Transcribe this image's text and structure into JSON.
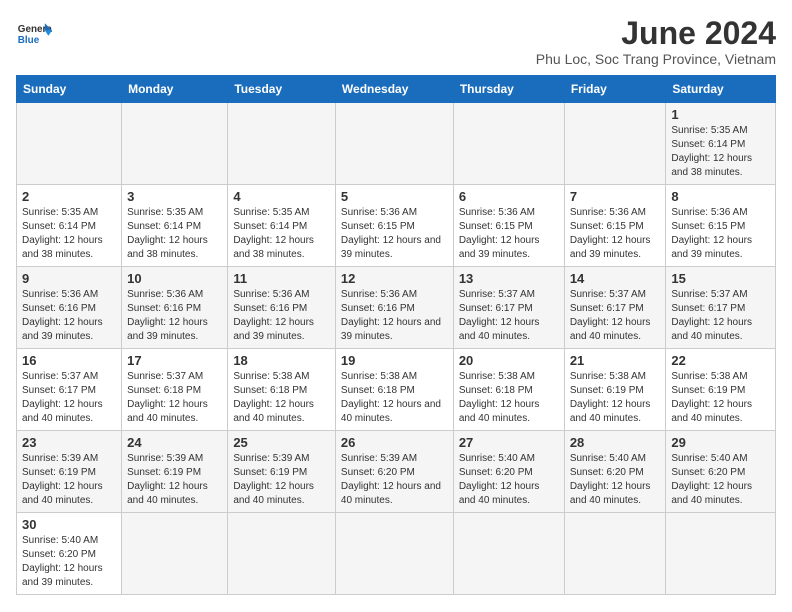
{
  "header": {
    "logo_general": "General",
    "logo_blue": "Blue",
    "month_title": "June 2024",
    "subtitle": "Phu Loc, Soc Trang Province, Vietnam"
  },
  "days_of_week": [
    "Sunday",
    "Monday",
    "Tuesday",
    "Wednesday",
    "Thursday",
    "Friday",
    "Saturday"
  ],
  "weeks": [
    [
      {
        "day": "",
        "info": ""
      },
      {
        "day": "",
        "info": ""
      },
      {
        "day": "",
        "info": ""
      },
      {
        "day": "",
        "info": ""
      },
      {
        "day": "",
        "info": ""
      },
      {
        "day": "",
        "info": ""
      },
      {
        "day": "1",
        "info": "Sunrise: 5:35 AM\nSunset: 6:14 PM\nDaylight: 12 hours and 38 minutes."
      }
    ],
    [
      {
        "day": "2",
        "info": "Sunrise: 5:35 AM\nSunset: 6:14 PM\nDaylight: 12 hours and 38 minutes."
      },
      {
        "day": "3",
        "info": "Sunrise: 5:35 AM\nSunset: 6:14 PM\nDaylight: 12 hours and 38 minutes."
      },
      {
        "day": "4",
        "info": "Sunrise: 5:35 AM\nSunset: 6:14 PM\nDaylight: 12 hours and 38 minutes."
      },
      {
        "day": "5",
        "info": "Sunrise: 5:36 AM\nSunset: 6:15 PM\nDaylight: 12 hours and 39 minutes."
      },
      {
        "day": "6",
        "info": "Sunrise: 5:36 AM\nSunset: 6:15 PM\nDaylight: 12 hours and 39 minutes."
      },
      {
        "day": "7",
        "info": "Sunrise: 5:36 AM\nSunset: 6:15 PM\nDaylight: 12 hours and 39 minutes."
      },
      {
        "day": "8",
        "info": "Sunrise: 5:36 AM\nSunset: 6:15 PM\nDaylight: 12 hours and 39 minutes."
      }
    ],
    [
      {
        "day": "9",
        "info": "Sunrise: 5:36 AM\nSunset: 6:16 PM\nDaylight: 12 hours and 39 minutes."
      },
      {
        "day": "10",
        "info": "Sunrise: 5:36 AM\nSunset: 6:16 PM\nDaylight: 12 hours and 39 minutes."
      },
      {
        "day": "11",
        "info": "Sunrise: 5:36 AM\nSunset: 6:16 PM\nDaylight: 12 hours and 39 minutes."
      },
      {
        "day": "12",
        "info": "Sunrise: 5:36 AM\nSunset: 6:16 PM\nDaylight: 12 hours and 39 minutes."
      },
      {
        "day": "13",
        "info": "Sunrise: 5:37 AM\nSunset: 6:17 PM\nDaylight: 12 hours and 40 minutes."
      },
      {
        "day": "14",
        "info": "Sunrise: 5:37 AM\nSunset: 6:17 PM\nDaylight: 12 hours and 40 minutes."
      },
      {
        "day": "15",
        "info": "Sunrise: 5:37 AM\nSunset: 6:17 PM\nDaylight: 12 hours and 40 minutes."
      }
    ],
    [
      {
        "day": "16",
        "info": "Sunrise: 5:37 AM\nSunset: 6:17 PM\nDaylight: 12 hours and 40 minutes."
      },
      {
        "day": "17",
        "info": "Sunrise: 5:37 AM\nSunset: 6:18 PM\nDaylight: 12 hours and 40 minutes."
      },
      {
        "day": "18",
        "info": "Sunrise: 5:38 AM\nSunset: 6:18 PM\nDaylight: 12 hours and 40 minutes."
      },
      {
        "day": "19",
        "info": "Sunrise: 5:38 AM\nSunset: 6:18 PM\nDaylight: 12 hours and 40 minutes."
      },
      {
        "day": "20",
        "info": "Sunrise: 5:38 AM\nSunset: 6:18 PM\nDaylight: 12 hours and 40 minutes."
      },
      {
        "day": "21",
        "info": "Sunrise: 5:38 AM\nSunset: 6:19 PM\nDaylight: 12 hours and 40 minutes."
      },
      {
        "day": "22",
        "info": "Sunrise: 5:38 AM\nSunset: 6:19 PM\nDaylight: 12 hours and 40 minutes."
      }
    ],
    [
      {
        "day": "23",
        "info": "Sunrise: 5:39 AM\nSunset: 6:19 PM\nDaylight: 12 hours and 40 minutes."
      },
      {
        "day": "24",
        "info": "Sunrise: 5:39 AM\nSunset: 6:19 PM\nDaylight: 12 hours and 40 minutes."
      },
      {
        "day": "25",
        "info": "Sunrise: 5:39 AM\nSunset: 6:19 PM\nDaylight: 12 hours and 40 minutes."
      },
      {
        "day": "26",
        "info": "Sunrise: 5:39 AM\nSunset: 6:20 PM\nDaylight: 12 hours and 40 minutes."
      },
      {
        "day": "27",
        "info": "Sunrise: 5:40 AM\nSunset: 6:20 PM\nDaylight: 12 hours and 40 minutes."
      },
      {
        "day": "28",
        "info": "Sunrise: 5:40 AM\nSunset: 6:20 PM\nDaylight: 12 hours and 40 minutes."
      },
      {
        "day": "29",
        "info": "Sunrise: 5:40 AM\nSunset: 6:20 PM\nDaylight: 12 hours and 40 minutes."
      }
    ],
    [
      {
        "day": "30",
        "info": "Sunrise: 5:40 AM\nSunset: 6:20 PM\nDaylight: 12 hours and 39 minutes."
      },
      {
        "day": "",
        "info": ""
      },
      {
        "day": "",
        "info": ""
      },
      {
        "day": "",
        "info": ""
      },
      {
        "day": "",
        "info": ""
      },
      {
        "day": "",
        "info": ""
      },
      {
        "day": "",
        "info": ""
      }
    ]
  ]
}
